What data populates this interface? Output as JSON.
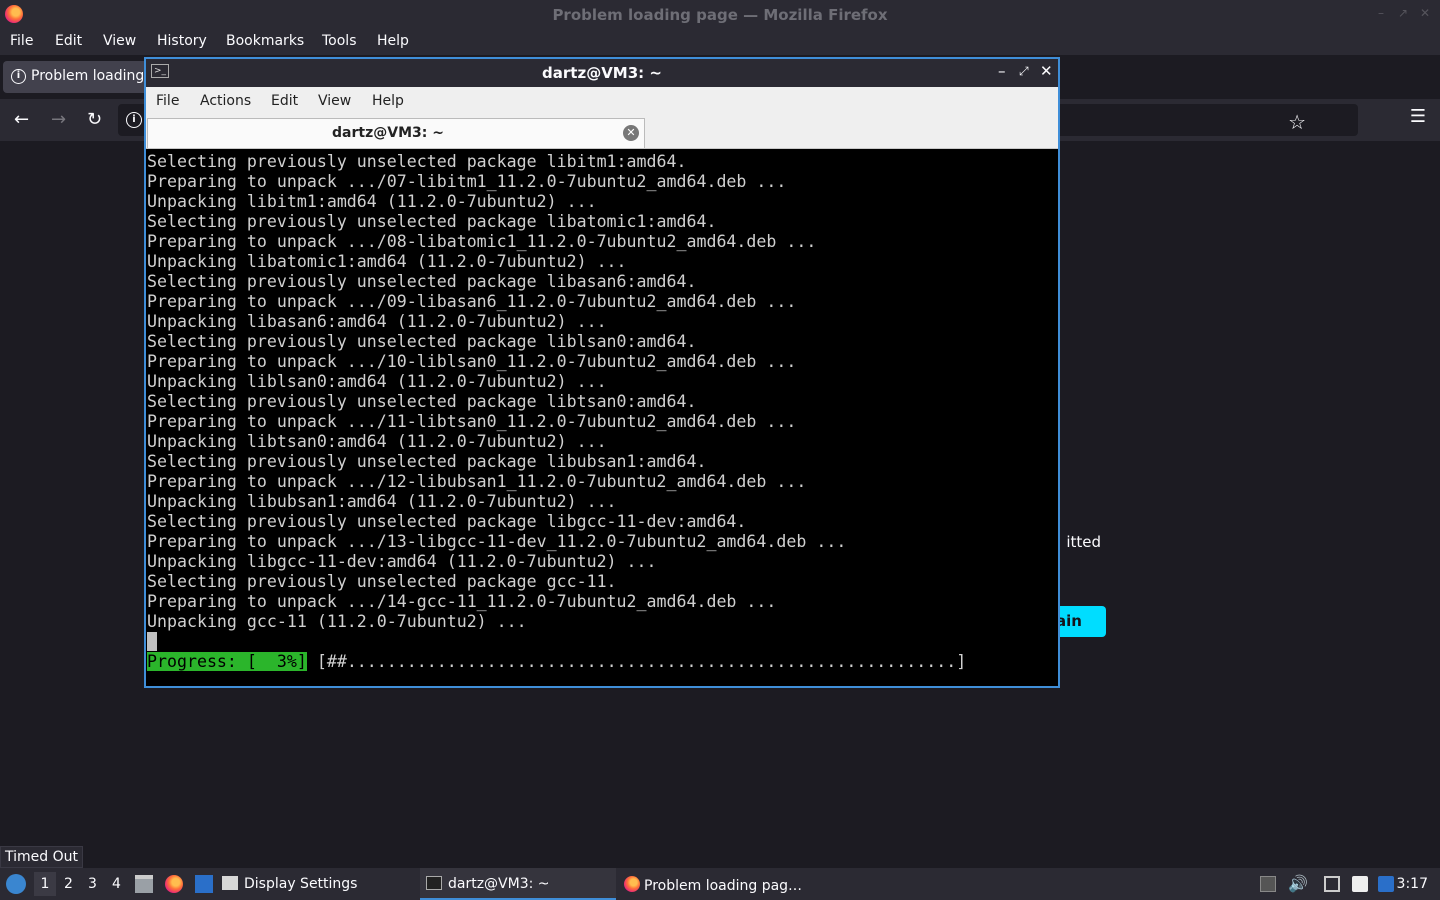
{
  "firefox": {
    "window_title": "Problem loading page — Mozilla Firefox",
    "menu": [
      "File",
      "Edit",
      "View",
      "History",
      "Bookmarks",
      "Tools",
      "Help"
    ],
    "tab_label": "Problem loading page",
    "error_text_fragment": "itted",
    "try_again_label": "ain",
    "status_tooltip": "Timed Out"
  },
  "terminal": {
    "window_title": "dartz@VM3: ~",
    "menu": [
      "File",
      "Actions",
      "Edit",
      "View",
      "Help"
    ],
    "tab_label": "dartz@VM3: ~",
    "output_lines": [
      "Selecting previously unselected package libitm1:amd64.",
      "Preparing to unpack .../07-libitm1_11.2.0-7ubuntu2_amd64.deb ...",
      "Unpacking libitm1:amd64 (11.2.0-7ubuntu2) ...",
      "Selecting previously unselected package libatomic1:amd64.",
      "Preparing to unpack .../08-libatomic1_11.2.0-7ubuntu2_amd64.deb ...",
      "Unpacking libatomic1:amd64 (11.2.0-7ubuntu2) ...",
      "Selecting previously unselected package libasan6:amd64.",
      "Preparing to unpack .../09-libasan6_11.2.0-7ubuntu2_amd64.deb ...",
      "Unpacking libasan6:amd64 (11.2.0-7ubuntu2) ...",
      "Selecting previously unselected package liblsan0:amd64.",
      "Preparing to unpack .../10-liblsan0_11.2.0-7ubuntu2_amd64.deb ...",
      "Unpacking liblsan0:amd64 (11.2.0-7ubuntu2) ...",
      "Selecting previously unselected package libtsan0:amd64.",
      "Preparing to unpack .../11-libtsan0_11.2.0-7ubuntu2_amd64.deb ...",
      "Unpacking libtsan0:amd64 (11.2.0-7ubuntu2) ...",
      "Selecting previously unselected package libubsan1:amd64.",
      "Preparing to unpack .../12-libubsan1_11.2.0-7ubuntu2_amd64.deb ...",
      "Unpacking libubsan1:amd64 (11.2.0-7ubuntu2) ...",
      "Selecting previously unselected package libgcc-11-dev:amd64.",
      "Preparing to unpack .../13-libgcc-11-dev_11.2.0-7ubuntu2_amd64.deb ...",
      "Unpacking libgcc-11-dev:amd64 (11.2.0-7ubuntu2) ...",
      "Selecting previously unselected package gcc-11.",
      "Preparing to unpack .../14-gcc-11_11.2.0-7ubuntu2_amd64.deb ...",
      "Unpacking gcc-11 (11.2.0-7ubuntu2) ..."
    ],
    "progress_label": "Progress: [  3%]",
    "progress_bar": " [##.............................................................]",
    "progress_percent": 3
  },
  "taskbar": {
    "workspaces": [
      "1",
      "2",
      "3",
      "4"
    ],
    "tasks": [
      "Display Settings",
      "dartz@VM3: ~",
      "Problem loading pag…"
    ],
    "clock": "3:17"
  },
  "icons": {
    "firefox": "firefox-logo-icon",
    "terminal": "terminal-icon",
    "start": "start-menu-icon"
  },
  "colors": {
    "accent": "#3f8ed8",
    "progress_green": "#2bb52b",
    "try_again_cyan": "#00ddff"
  }
}
